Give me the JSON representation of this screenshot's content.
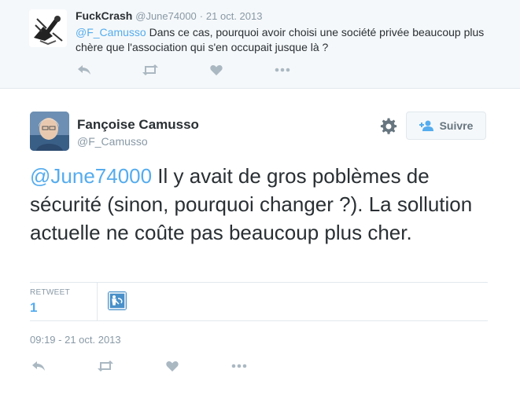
{
  "reply": {
    "author_name": "FuckCrash",
    "author_handle": "@June74000",
    "separator": "·",
    "date": "21 oct. 2013",
    "mention": "@F_Camusso",
    "text": " Dans ce cas, pourquoi avoir choisi une société privée beaucoup plus chère que l'association qui s'en occupait jusque là ?"
  },
  "main": {
    "author_name": "Fançoise Camusso",
    "author_handle": "@F_Camusso",
    "follow_label": "Suivre",
    "mention": "@June74000",
    "text": " Il y avait de gros poblèmes de sécurité (sinon, pourquoi changer ?). La sollution actuelle ne coûte pas beaucoup plus cher.",
    "retweet_label": "RETWEET",
    "retweet_count": "1",
    "timestamp": "09:19 - 21 oct. 2013"
  },
  "colors": {
    "link": "#55acee",
    "icon_gray": "#aab8c2",
    "muted": "#8899a6",
    "text": "#292f33"
  },
  "icons": [
    "reply-icon",
    "retweet-icon",
    "like-icon",
    "more-icon",
    "gear-icon",
    "follow-person-icon"
  ]
}
